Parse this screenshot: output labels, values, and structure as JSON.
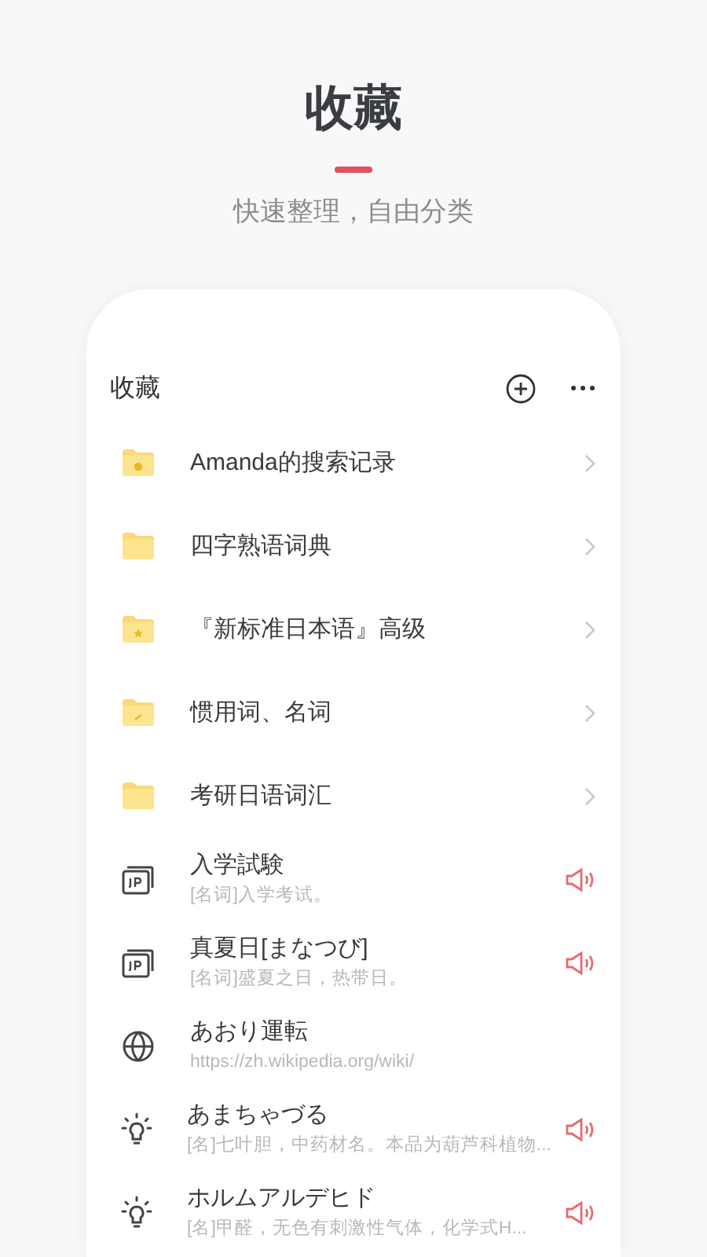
{
  "page": {
    "title": "收藏",
    "subtitle": "快速整理，自由分类"
  },
  "panel": {
    "title": "收藏"
  },
  "folders": [
    {
      "name": "Amanda的搜索记录",
      "kind": "history"
    },
    {
      "name": "四字熟语词典",
      "kind": "plain"
    },
    {
      "name": "『新标准日本语』高级",
      "kind": "starred"
    },
    {
      "name": "惯用词、名词",
      "kind": "edited"
    },
    {
      "name": "考研日语词汇",
      "kind": "plain"
    }
  ],
  "entries": [
    {
      "kind": "jp",
      "word": "入学試験",
      "detail": "[名词]入学考试。",
      "audio": true
    },
    {
      "kind": "jp",
      "word": "真夏日[まなつび]",
      "detail": "[名词]盛夏之日，热带日。",
      "audio": true
    },
    {
      "kind": "web",
      "word": "あおり運転",
      "detail": "https://zh.wikipedia.org/wiki/",
      "audio": false
    },
    {
      "kind": "tip",
      "word": "あまちゃづる",
      "detail": "[名]七叶胆，中药材名。本品为葫芦科植物...",
      "audio": true
    },
    {
      "kind": "tip",
      "word": "ホルムアルデヒド",
      "detail": "[名]甲醛，无色有刺激性气体，化学式H...",
      "audio": true
    }
  ]
}
